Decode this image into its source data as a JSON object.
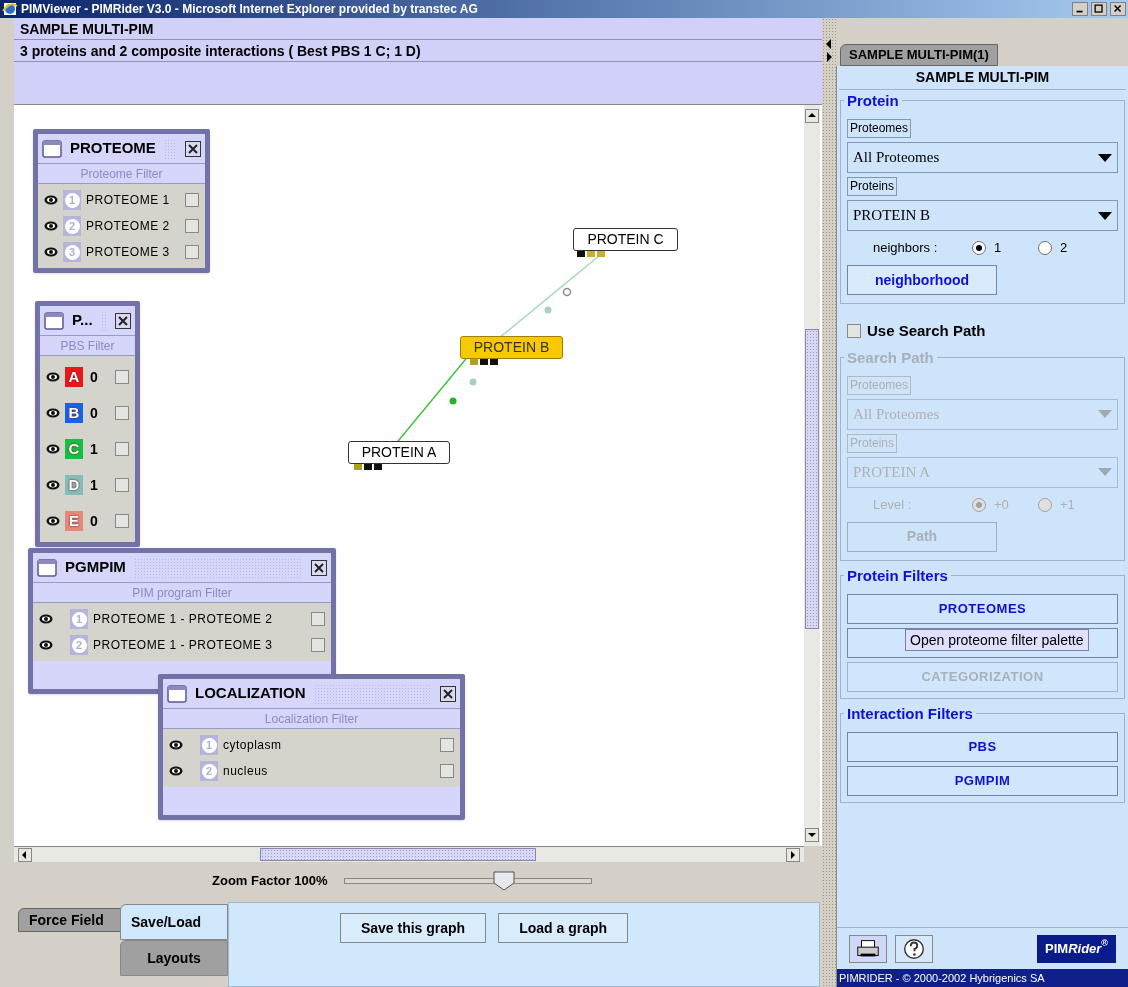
{
  "window": {
    "title": "PIMViewer - PIMRider V3.0 - Microsoft Internet Explorer provided by transtec AG"
  },
  "header": {
    "title": "SAMPLE MULTI-PIM",
    "summary": "3 proteins and 2 composite interactions ( Best PBS 1 C; 1 D)"
  },
  "graph": {
    "nodes": [
      {
        "label": "PROTEIN C",
        "selected": false
      },
      {
        "label": "PROTEIN B",
        "selected": true
      },
      {
        "label": "PROTEIN A",
        "selected": false
      }
    ]
  },
  "palettes": [
    {
      "title": "PROTEOME",
      "filter": "Proteome Filter",
      "rows": [
        {
          "kind": "number",
          "badge": "1",
          "label": "PROTEOME 1",
          "checked": false
        },
        {
          "kind": "number",
          "badge": "2",
          "label": "PROTEOME 2",
          "checked": false
        },
        {
          "kind": "number",
          "badge": "3",
          "label": "PROTEOME 3",
          "checked": false
        }
      ]
    },
    {
      "title": "P...",
      "filter": "PBS Filter",
      "rows": [
        {
          "kind": "letter",
          "badge": "A",
          "color": "#e81818",
          "label": "0",
          "checked": false
        },
        {
          "kind": "letter",
          "badge": "B",
          "color": "#1464e6",
          "label": "0",
          "checked": false
        },
        {
          "kind": "letter",
          "badge": "C",
          "color": "#14c040",
          "label": "1",
          "checked": false
        },
        {
          "kind": "letter",
          "badge": "D",
          "color": "#84bcb8",
          "label": "1",
          "checked": false
        },
        {
          "kind": "letter",
          "badge": "E",
          "color": "#e48878",
          "label": "0",
          "checked": false
        }
      ]
    },
    {
      "title": "PGMPIM",
      "filter": "PIM program Filter",
      "rows": [
        {
          "kind": "number",
          "badge": "1",
          "label": "PROTEOME 1 - PROTEOME 2",
          "checked": false
        },
        {
          "kind": "number",
          "badge": "2",
          "label": "PROTEOME 1 - PROTEOME 3",
          "checked": false
        }
      ]
    },
    {
      "title": "LOCALIZATION",
      "filter": "Localization Filter",
      "rows": [
        {
          "kind": "number",
          "badge": "1",
          "label": "cytoplasm",
          "checked": false
        },
        {
          "kind": "number",
          "badge": "2",
          "label": "nucleus",
          "checked": false
        }
      ]
    }
  ],
  "zoom": {
    "label": "Zoom Factor 100%",
    "level": 0.645
  },
  "bottom_tabs": [
    {
      "label": "Force Field",
      "selected": false
    },
    {
      "label": "Save/Load",
      "selected": true
    },
    {
      "label": "Layouts",
      "selected": false
    }
  ],
  "bottom_buttons": [
    "Save this graph",
    "Load a graph"
  ],
  "side_tabs": [
    {
      "label": "SAMPLE MULTI-PIM(1)",
      "selected": false
    },
    {
      "label": "SAMPLE MULTI-PIM",
      "selected": true
    }
  ],
  "protein": {
    "title": "Protein",
    "disabled": false,
    "proteomes_label": "Proteomes",
    "proteomes_value": "All Proteomes",
    "proteins_label": "Proteins",
    "proteins_value": "PROTEIN B",
    "option_label": "neighbors :",
    "options": [
      {
        "label": "1",
        "selected": true
      },
      {
        "label": "2",
        "selected": false
      }
    ],
    "button": "neighborhood"
  },
  "use_search_path": {
    "label": "Use Search Path",
    "checked": false
  },
  "search_path": {
    "title": "Search Path",
    "disabled": true,
    "proteomes_label": "Proteomes",
    "proteomes_value": "All Proteomes",
    "proteins_label": "Proteins",
    "proteins_value": "PROTEIN A",
    "option_label": "Level :",
    "options": [
      {
        "label": "+0",
        "selected": true
      },
      {
        "label": "+1",
        "selected": false
      }
    ],
    "button": "Path"
  },
  "protein_filters": {
    "title": "Protein Filters",
    "buttons": [
      {
        "label": "PROTEOMES",
        "disabled": false
      },
      {
        "disabled": false
      },
      {
        "label": "CATEGORIZATION",
        "disabled": true
      }
    ]
  },
  "tooltip": "Open proteome filter palette",
  "interaction_filters": {
    "title": "Interaction Filters",
    "buttons": [
      {
        "label": "PBS",
        "disabled": false
      },
      {
        "label": "PGMPIM",
        "disabled": false
      }
    ]
  },
  "logo": {
    "first": "PIM",
    "second": "Rider",
    "mark": "®"
  },
  "status_bar": "PIMRIDER - © 2000-2002 Hybrigenics SA"
}
